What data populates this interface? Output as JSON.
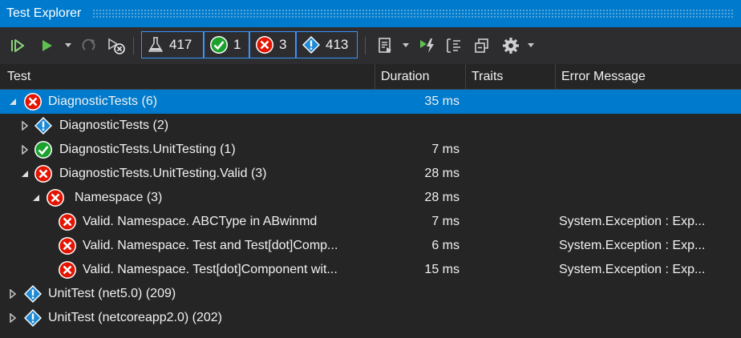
{
  "window": {
    "title": "Test Explorer"
  },
  "toolbar": {
    "counters": {
      "total": "417",
      "passed": "1",
      "failed": "3",
      "not_run": "413"
    }
  },
  "columns": {
    "test": "Test",
    "duration": "Duration",
    "traits": "Traits",
    "error": "Error Message"
  },
  "rows": [
    {
      "name": "DiagnosticTests",
      "count": "(6)",
      "duration": "35 ms",
      "error": "",
      "status": "failed",
      "expander": "expanded",
      "selected": true
    },
    {
      "name": "DiagnosticTests",
      "count": "(2)",
      "duration": "",
      "error": "",
      "status": "not-run",
      "expander": "collapsed",
      "selected": false
    },
    {
      "name": "DiagnosticTests.UnitTesting",
      "count": "(1)",
      "duration": "7 ms",
      "error": "",
      "status": "passed",
      "expander": "collapsed",
      "selected": false
    },
    {
      "name": "DiagnosticTests.UnitTesting.Valid",
      "count": "(3)",
      "duration": "28 ms",
      "error": "",
      "status": "failed",
      "expander": "expanded",
      "selected": false
    },
    {
      "name": "Namespace",
      "count": "(3)",
      "duration": "28 ms",
      "error": "",
      "status": "failed",
      "expander": "expanded",
      "selected": false
    },
    {
      "name": "Valid. Namespace. ABCType in ABwinmd",
      "count": "",
      "duration": "7 ms",
      "error": "System.Exception : Exp...",
      "status": "failed",
      "expander": "none",
      "selected": false
    },
    {
      "name": "Valid. Namespace. Test and Test[dot]Comp...",
      "count": "",
      "duration": "6 ms",
      "error": "System.Exception : Exp...",
      "status": "failed",
      "expander": "none",
      "selected": false
    },
    {
      "name": "Valid. Namespace. Test[dot]Component wit...",
      "count": "",
      "duration": "15 ms",
      "error": "System.Exception : Exp...",
      "status": "failed",
      "expander": "none",
      "selected": false
    },
    {
      "name": "UnitTest (net5.0)",
      "count": "(209)",
      "duration": "",
      "error": "",
      "status": "not-run",
      "expander": "collapsed",
      "selected": false
    },
    {
      "name": "UnitTest (netcoreapp2.0)",
      "count": "(202)",
      "duration": "",
      "error": "",
      "status": "not-run",
      "expander": "collapsed",
      "selected": false
    }
  ],
  "colors": {
    "accent": "#007acc",
    "failed": "#e51400",
    "passed": "#1ba12e",
    "not_run": "#1e8ad6",
    "background": "#252526",
    "toolbar": "#2d2d30"
  },
  "icons": {
    "run_all": "run-all-icon",
    "run": "run-icon",
    "repeat_last_run": "repeat-run-icon",
    "cancel": "cancel-run-icon",
    "playlist": "playlist-icon",
    "run_on_build": "run-on-build-icon",
    "group_by": "group-by-icon",
    "expand_collapse": "expand-collapse-icon",
    "settings": "settings-icon"
  }
}
